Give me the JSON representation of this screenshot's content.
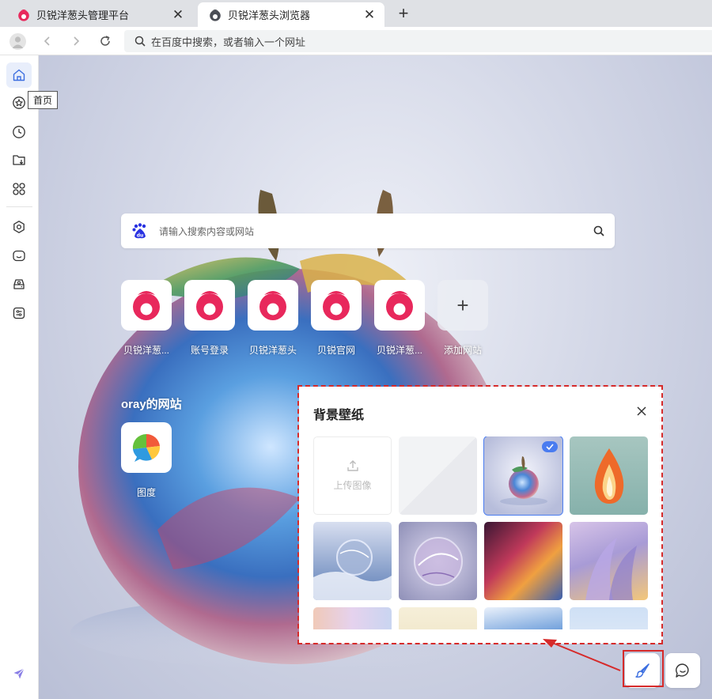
{
  "tabs": [
    {
      "title": "贝锐洋葱头管理平台",
      "active": false
    },
    {
      "title": "贝锐洋葱头浏览器",
      "active": true
    }
  ],
  "address_bar": {
    "placeholder": "在百度中搜索，或者输入一个网址"
  },
  "sidebar": {
    "items": [
      "home-icon",
      "star-icon",
      "clock-icon",
      "folder-download-icon",
      "apps-icon",
      "gear-icon",
      "chat-icon",
      "drive-icon",
      "toolbox-icon",
      "send-icon"
    ],
    "tooltip": "首页"
  },
  "search": {
    "placeholder": "请输入搜索内容或网站"
  },
  "sites": [
    {
      "label": "贝锐洋葱..."
    },
    {
      "label": "账号登录"
    },
    {
      "label": "贝锐洋葱头"
    },
    {
      "label": "贝锐官网"
    },
    {
      "label": "贝锐洋葱..."
    },
    {
      "label": "添加网站"
    }
  ],
  "oray_section": {
    "title": "oray的网站",
    "sites": [
      {
        "label": "图度"
      }
    ]
  },
  "wallpaper_panel": {
    "title": "背景壁纸",
    "upload_label": "上传图像",
    "selected_index": 2
  },
  "colors": {
    "accent": "#4a7cf0",
    "brand": "#e8285c",
    "annotation": "#d62a2a"
  }
}
